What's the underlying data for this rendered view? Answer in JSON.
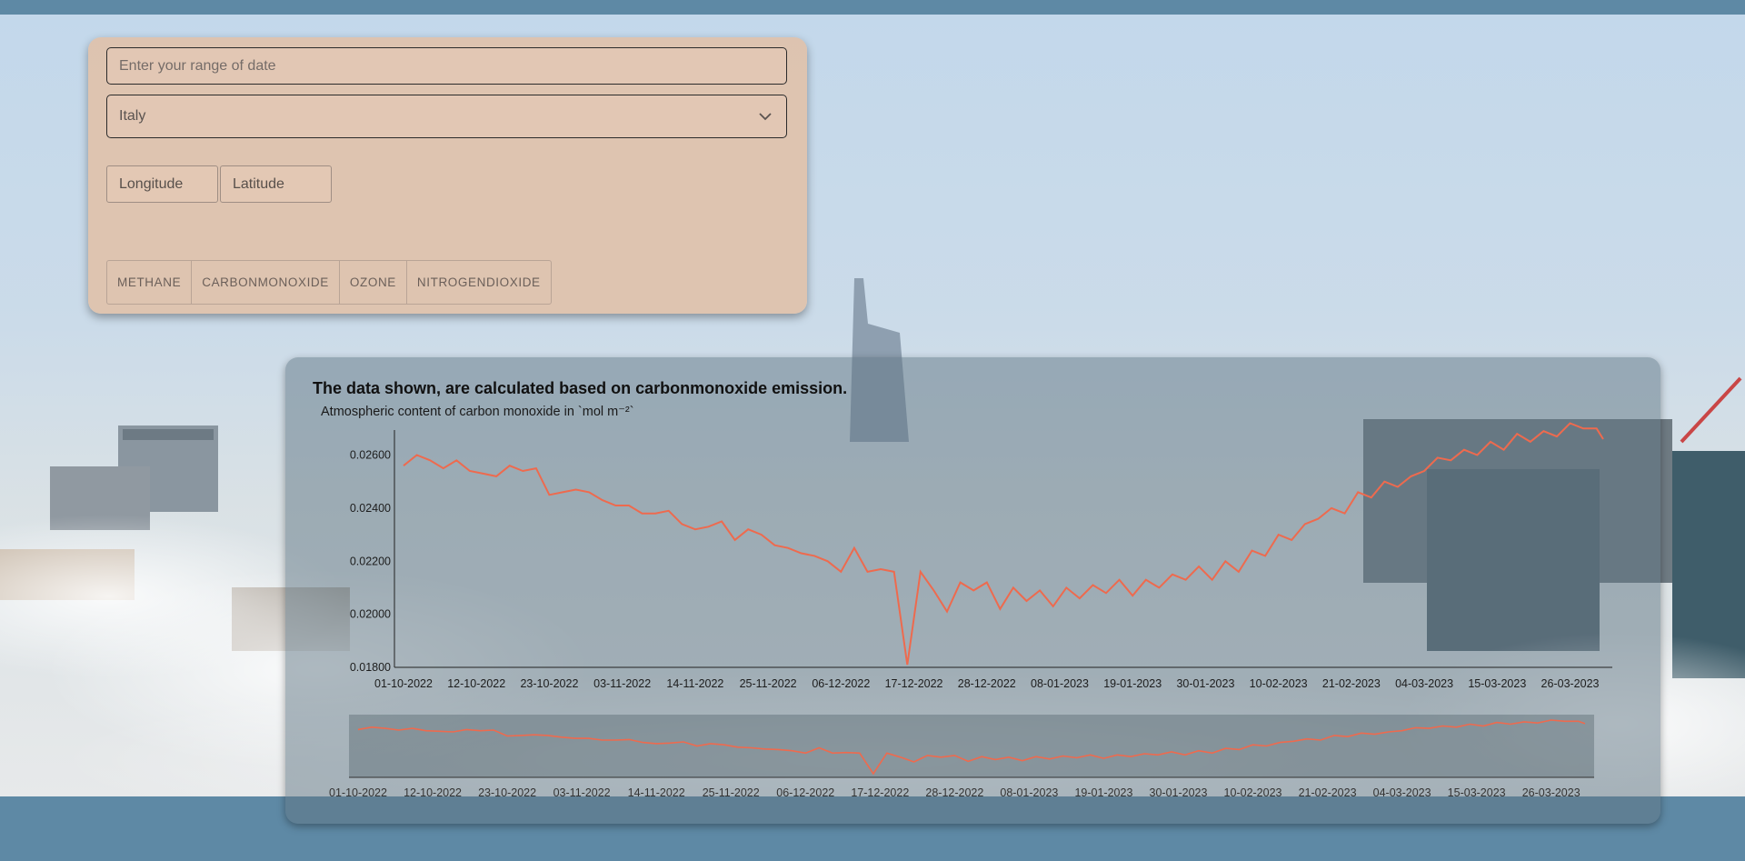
{
  "controls": {
    "date_placeholder": "Enter your range of date",
    "country_selected": "Italy",
    "longitude_label": "Longitude",
    "latitude_label": "Latitude",
    "gas_buttons": [
      "METHANE",
      "CARBONMONOXIDE",
      "OZONE",
      "NITROGENDIOXIDE"
    ]
  },
  "card": {
    "heading": "The data shown, are calculated based on carbonmonoxide emission."
  },
  "colors": {
    "line": "#ee6a4e",
    "panel": "#e0c1aa",
    "card": "#607684"
  },
  "chart_data": {
    "type": "line",
    "title": "Atmospheric content of carbon monoxide in `mol m⁻²`",
    "x_tick_labels": [
      "01-10-2022",
      "12-10-2022",
      "23-10-2022",
      "03-11-2022",
      "14-11-2022",
      "25-11-2022",
      "06-12-2022",
      "17-12-2022",
      "28-12-2022",
      "08-01-2023",
      "19-01-2023",
      "30-01-2023",
      "10-02-2023",
      "21-02-2023",
      "04-03-2023",
      "15-03-2023",
      "26-03-2023"
    ],
    "y_tick_labels": [
      "0.01800",
      "0.02000",
      "0.02200",
      "0.02400",
      "0.02600"
    ],
    "ylim": [
      0.018,
      0.0266
    ],
    "grid": false,
    "has_navigator": true,
    "series": [
      {
        "x": [
          "01-10-2022",
          "03-10-2022",
          "05-10-2022",
          "07-10-2022",
          "09-10-2022",
          "11-10-2022",
          "13-10-2022",
          "15-10-2022",
          "17-10-2022",
          "19-10-2022",
          "21-10-2022",
          "23-10-2022",
          "25-10-2022",
          "27-10-2022",
          "29-10-2022",
          "31-10-2022",
          "02-11-2022",
          "04-11-2022",
          "06-11-2022",
          "08-11-2022",
          "10-11-2022",
          "12-11-2022",
          "14-11-2022",
          "16-11-2022",
          "18-11-2022",
          "20-11-2022",
          "22-11-2022",
          "24-11-2022",
          "26-11-2022",
          "28-11-2022",
          "30-11-2022",
          "02-12-2022",
          "04-12-2022",
          "06-12-2022",
          "08-12-2022",
          "10-12-2022",
          "12-12-2022",
          "14-12-2022",
          "16-12-2022",
          "18-12-2022",
          "20-12-2022",
          "22-12-2022",
          "24-12-2022",
          "26-12-2022",
          "28-12-2022",
          "30-12-2022",
          "01-01-2023",
          "03-01-2023",
          "05-01-2023",
          "07-01-2023",
          "09-01-2023",
          "11-01-2023",
          "13-01-2023",
          "15-01-2023",
          "17-01-2023",
          "19-01-2023",
          "21-01-2023",
          "23-01-2023",
          "25-01-2023",
          "27-01-2023",
          "29-01-2023",
          "31-01-2023",
          "02-02-2023",
          "04-02-2023",
          "06-02-2023",
          "08-02-2023",
          "10-02-2023",
          "12-02-2023",
          "14-02-2023",
          "16-02-2023",
          "18-02-2023",
          "20-02-2023",
          "22-02-2023",
          "24-02-2023",
          "26-02-2023",
          "28-02-2023",
          "02-03-2023",
          "04-03-2023",
          "06-03-2023",
          "08-03-2023",
          "10-03-2023",
          "12-03-2023",
          "14-03-2023",
          "16-03-2023",
          "18-03-2023",
          "20-03-2023",
          "22-03-2023",
          "24-03-2023",
          "26-03-2023",
          "28-03-2023",
          "30-03-2023",
          "31-03-2023"
        ],
        "values": [
          0.0256,
          0.026,
          0.0258,
          0.0255,
          0.0258,
          0.0254,
          0.0253,
          0.0252,
          0.0256,
          0.0254,
          0.0255,
          0.0245,
          0.0246,
          0.0247,
          0.0246,
          0.0243,
          0.0241,
          0.0241,
          0.0238,
          0.0238,
          0.0239,
          0.0234,
          0.0232,
          0.0233,
          0.0235,
          0.0228,
          0.0232,
          0.023,
          0.0226,
          0.0225,
          0.0223,
          0.0222,
          0.022,
          0.0216,
          0.0225,
          0.0216,
          0.0217,
          0.0216,
          0.0181,
          0.0216,
          0.0209,
          0.0201,
          0.0212,
          0.0209,
          0.0212,
          0.0202,
          0.021,
          0.0205,
          0.0209,
          0.0203,
          0.021,
          0.0206,
          0.0211,
          0.0208,
          0.0213,
          0.0207,
          0.0213,
          0.021,
          0.0215,
          0.0213,
          0.0218,
          0.0213,
          0.022,
          0.0216,
          0.0224,
          0.0222,
          0.023,
          0.0228,
          0.0234,
          0.0236,
          0.024,
          0.0238,
          0.0246,
          0.0244,
          0.025,
          0.0248,
          0.0252,
          0.0254,
          0.0259,
          0.0258,
          0.0262,
          0.026,
          0.0265,
          0.0262,
          0.0268,
          0.0265,
          0.0269,
          0.0267,
          0.0272,
          0.027,
          0.027,
          0.0266
        ]
      }
    ]
  }
}
